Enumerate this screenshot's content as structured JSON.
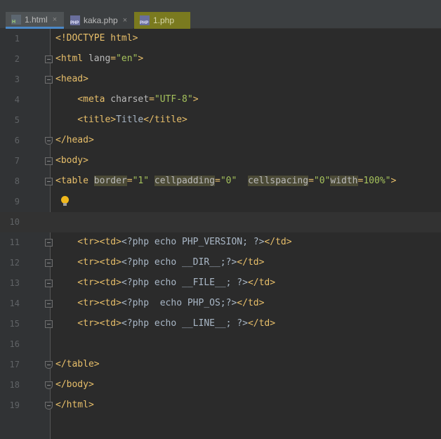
{
  "tabs": [
    {
      "label": "1.html",
      "icon": "html-file-icon",
      "active": true
    },
    {
      "label": "kaka.php",
      "icon": "php-file-icon",
      "active": false
    },
    {
      "label": "1.php",
      "icon": "php-file-icon",
      "active": false
    }
  ],
  "close_glyph": "×",
  "lines": [
    {
      "num": "1",
      "fold": "none",
      "tokens": [
        [
          "tag",
          "<!DOCTYPE html>"
        ]
      ]
    },
    {
      "num": "2",
      "fold": "open",
      "tokens": [
        [
          "tag",
          "<html "
        ],
        [
          "attr",
          "lang"
        ],
        [
          "tag",
          "="
        ],
        [
          "val",
          "\"en\""
        ],
        [
          "tag",
          ">"
        ]
      ]
    },
    {
      "num": "3",
      "fold": "open",
      "tokens": [
        [
          "tag",
          "<head>"
        ]
      ]
    },
    {
      "num": "4",
      "fold": "none",
      "tokens": [
        [
          "tag",
          "    <meta "
        ],
        [
          "attr",
          "charset"
        ],
        [
          "tag",
          "="
        ],
        [
          "val",
          "\"UTF-8\""
        ],
        [
          "tag",
          ">"
        ]
      ]
    },
    {
      "num": "5",
      "fold": "none",
      "tokens": [
        [
          "tag",
          "    <title>"
        ],
        [
          "text",
          "Title"
        ],
        [
          "tag",
          "</title>"
        ]
      ]
    },
    {
      "num": "6",
      "fold": "end",
      "tokens": [
        [
          "tag",
          "</head>"
        ]
      ]
    },
    {
      "num": "7",
      "fold": "open",
      "tokens": [
        [
          "tag",
          "<body>"
        ]
      ]
    },
    {
      "num": "8",
      "fold": "open",
      "tokens": [
        [
          "tag",
          "<table "
        ],
        [
          "attrhl",
          "border"
        ],
        [
          "tag",
          "="
        ],
        [
          "val",
          "\"1\" "
        ],
        [
          "attrhl",
          "cellpadding"
        ],
        [
          "tag",
          "="
        ],
        [
          "val",
          "\"0\"  "
        ],
        [
          "attrhl",
          "cellspacing"
        ],
        [
          "tag",
          "="
        ],
        [
          "val",
          "\"0\""
        ],
        [
          "attrhl",
          "width"
        ],
        [
          "tag",
          "="
        ],
        [
          "val",
          "100%\""
        ],
        [
          "tag",
          ">"
        ]
      ]
    },
    {
      "num": "9",
      "fold": "none",
      "bulb": true,
      "tokens": []
    },
    {
      "num": "10",
      "fold": "none",
      "current": true,
      "tokens": []
    },
    {
      "num": "11",
      "fold": "open",
      "tokens": [
        [
          "tag",
          "    <tr><td>"
        ],
        [
          "text",
          "<?php echo PHP_VERSION; ?>"
        ],
        [
          "tag",
          "</td>"
        ]
      ]
    },
    {
      "num": "12",
      "fold": "open",
      "tokens": [
        [
          "tag",
          "    <tr><td>"
        ],
        [
          "text",
          "<?php echo __DIR__;?>"
        ],
        [
          "tag",
          "</td>"
        ]
      ]
    },
    {
      "num": "13",
      "fold": "open",
      "tokens": [
        [
          "tag",
          "    <tr><td>"
        ],
        [
          "text",
          "<?php echo __FILE__; ?>"
        ],
        [
          "tag",
          "</td>"
        ]
      ]
    },
    {
      "num": "14",
      "fold": "open",
      "tokens": [
        [
          "tag",
          "    <tr><td>"
        ],
        [
          "text",
          "<?php  echo PHP_OS;?>"
        ],
        [
          "tag",
          "</td>"
        ]
      ]
    },
    {
      "num": "15",
      "fold": "open",
      "tokens": [
        [
          "tag",
          "    <tr><td>"
        ],
        [
          "text",
          "<?php echo __LINE__; ?>"
        ],
        [
          "tag",
          "</td>"
        ]
      ]
    },
    {
      "num": "16",
      "fold": "none",
      "tokens": []
    },
    {
      "num": "17",
      "fold": "end",
      "tokens": [
        [
          "tag",
          "</table>"
        ]
      ]
    },
    {
      "num": "18",
      "fold": "end",
      "tokens": [
        [
          "tag",
          "</body>"
        ]
      ]
    },
    {
      "num": "19",
      "fold": "end",
      "tokens": [
        [
          "tag",
          "</html>"
        ]
      ]
    }
  ]
}
